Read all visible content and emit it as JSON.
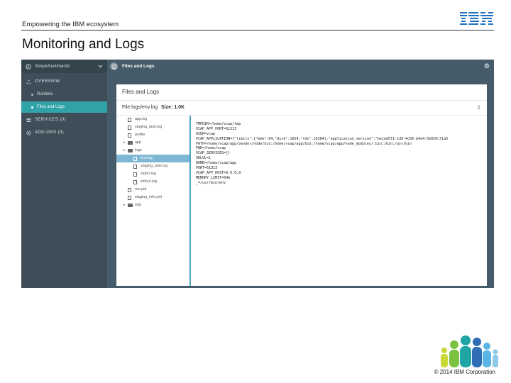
{
  "slide": {
    "header_text": "Empowering the IBM ecosystem",
    "title": "Monitoring and Logs",
    "footer_copyright": "© 2014 IBM Corporation",
    "logo_text": "IBM"
  },
  "app": {
    "app_name": "SimpleSentimentA",
    "sidebar": {
      "overview_label": "OVERVIEW",
      "items": [
        {
          "label": "Runtime"
        },
        {
          "label": "Files and Logs",
          "active": true
        }
      ],
      "services_label": "SERVICES (0)",
      "addons_label": "ADD-ONS (0)"
    },
    "topbar_title": "Files and Logs",
    "panel_title": "Files and Logs",
    "path_label": "File:logs/env.log",
    "size_label": "Size: 1.0K",
    "tree": [
      {
        "label": "app.log",
        "icon": "file-icon"
      },
      {
        "label": "staging_task.log",
        "icon": "file-icon"
      },
      {
        "label": "profile",
        "icon": "file-icon"
      },
      {
        "label": "app",
        "icon": "folder-icon",
        "expandable": true
      },
      {
        "label": "logs",
        "icon": "folder-icon",
        "expandable": true
      },
      {
        "label": "env.log",
        "icon": "file-icon",
        "selected": true
      },
      {
        "label": "staging_task.log",
        "icon": "file-icon"
      },
      {
        "label": "stderr.log",
        "icon": "file-icon"
      },
      {
        "label": "stdout.log",
        "icon": "file-icon"
      },
      {
        "label": "run.pid",
        "icon": "file-icon"
      },
      {
        "label": "staging_info.yml",
        "icon": "file-icon"
      },
      {
        "label": "tmp",
        "icon": "folder-icon",
        "expandable": true
      }
    ],
    "log_lines": [
      "TMPDIR=/home/vcap/tmp",
      "VCAP_APP_PORT=61313",
      "USER=vcap",
      "VCAP_APPLICATION={\"limits\":{\"mem\":64,\"disk\":1024,\"fds\":16384},\"application_version\":\"beced571-1d9-4c06-b4e4-5b020c71a5",
      "PATH=/home/vcap/app/vendor/node/bin:/home/vcap/app/bin:/home/vcap/app/node_modules/.bin:/bin:/usr/bin",
      "PWD=/home/vcap",
      "VCAP_SERVICES={}",
      "SHLVL=1",
      "HOME=/home/vcap/app",
      "PORT=61313",
      "VCAP_APP_HOST=0.0.0.0",
      "MEMORY_LIMIT=64m",
      "_=/usr/bin/env"
    ]
  },
  "colors": {
    "teal_active": "#2fa3a8",
    "sidebar_bg": "#3e4d57",
    "topbar_bg": "#465b69",
    "tree_selected": "#7fb8d4",
    "ibm_blue": "#1f70c1"
  }
}
